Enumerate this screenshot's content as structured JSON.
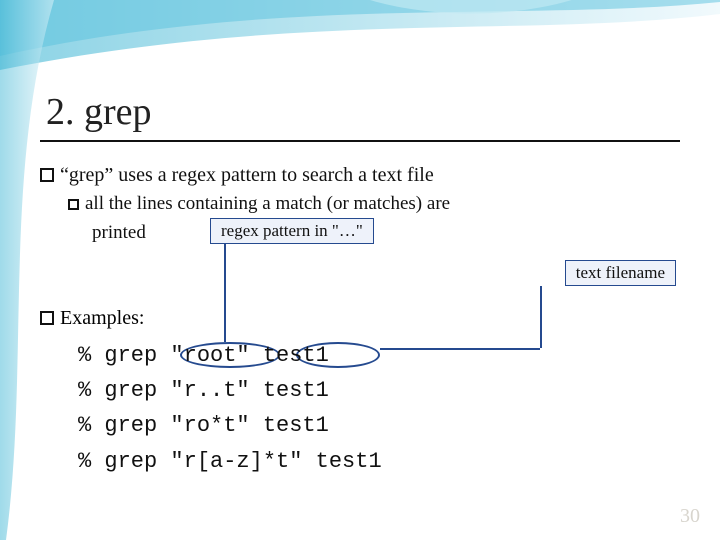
{
  "title": "2. grep",
  "bullet1": "“grep” uses a regex pattern to search a text file",
  "bullet2": "all the lines containing a match (or matches) are",
  "bullet2b": "printed",
  "callout_pattern": "regex pattern in \"…\"",
  "callout_filename": "text filename",
  "examples_label": "Examples:",
  "code": {
    "l1": "% grep \"root\" test1",
    "l2": "% grep \"r..t\" test1",
    "l3": "% grep \"ro*t\" test1",
    "l4": "% grep \"r[a-z]*t\" test1"
  },
  "page_number": "30"
}
